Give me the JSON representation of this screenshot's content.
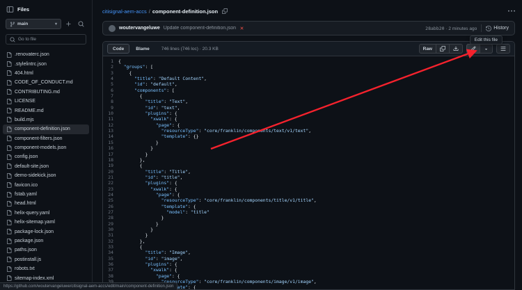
{
  "colors": {
    "accent": "#4493f8",
    "json_key": "#79c0ff",
    "json_string": "#a5d6ff",
    "danger": "#f85149",
    "arrow": "#f5222d"
  },
  "sidebar": {
    "title": "Files",
    "branch": {
      "name": "main"
    },
    "goto_placeholder": "Go to file",
    "selected_file": "component-definition.json",
    "files": [
      ".renovaterc.json",
      ".stylelintrc.json",
      "404.html",
      "CODE_OF_CONDUCT.md",
      "CONTRIBUTING.md",
      "LICENSE",
      "README.md",
      "build.mjs",
      "component-definition.json",
      "component-filters.json",
      "component-models.json",
      "config.json",
      "default-site.json",
      "demo-sidekick.json",
      "favicon.ico",
      "fstab.yaml",
      "head.html",
      "helix-query.yaml",
      "helix-sitemap.yaml",
      "package-lock.json",
      "package.json",
      "paths.json",
      "postinstall.js",
      "robots.txt",
      "sitemap-index.xml"
    ]
  },
  "breadcrumb": {
    "repo": "citisignal-aem-accs",
    "separator": "/",
    "file": "component-definition.json"
  },
  "commit": {
    "author": "woutervangeluwe",
    "message": "Update component-definition.json",
    "sha": "28abb20",
    "separator": "·",
    "time": "2 minutes ago",
    "history": "History"
  },
  "toolbar": {
    "code": "Code",
    "blame": "Blame",
    "stats": "746 lines (746 loc) · 20.3 KB",
    "raw": "Raw"
  },
  "tooltip": "Edit this file",
  "code_lines": [
    "{",
    "  \"groups\": [",
    "    {",
    "      \"title\": \"Default Content\",",
    "      \"id\": \"default\",",
    "      \"components\": [",
    "        {",
    "          \"title\": \"Text\",",
    "          \"id\": \"text\",",
    "          \"plugins\": {",
    "            \"xwalk\": {",
    "              \"page\": {",
    "                \"resourceType\": \"core/franklin/components/text/v1/text\",",
    "                \"template\": {}",
    "              }",
    "            }",
    "          }",
    "        },",
    "        {",
    "          \"title\": \"Title\",",
    "          \"id\": \"title\",",
    "          \"plugins\": {",
    "            \"xwalk\": {",
    "              \"page\": {",
    "                \"resourceType\": \"core/franklin/components/title/v1/title\",",
    "                \"template\": {",
    "                  \"model\": \"title\"",
    "                }",
    "              }",
    "            }",
    "          }",
    "        },",
    "        {",
    "          \"title\": \"Image\",",
    "          \"id\": \"image\",",
    "          \"plugins\": {",
    "            \"xwalk\": {",
    "              \"page\": {",
    "                \"resourceType\": \"core/franklin/components/image/v1/image\",",
    "                \"template\": {"
  ],
  "statusbar_url": "https://github.com/woutervangeluwe/citisignal-aem-accs/edit/main/component-definition.json"
}
